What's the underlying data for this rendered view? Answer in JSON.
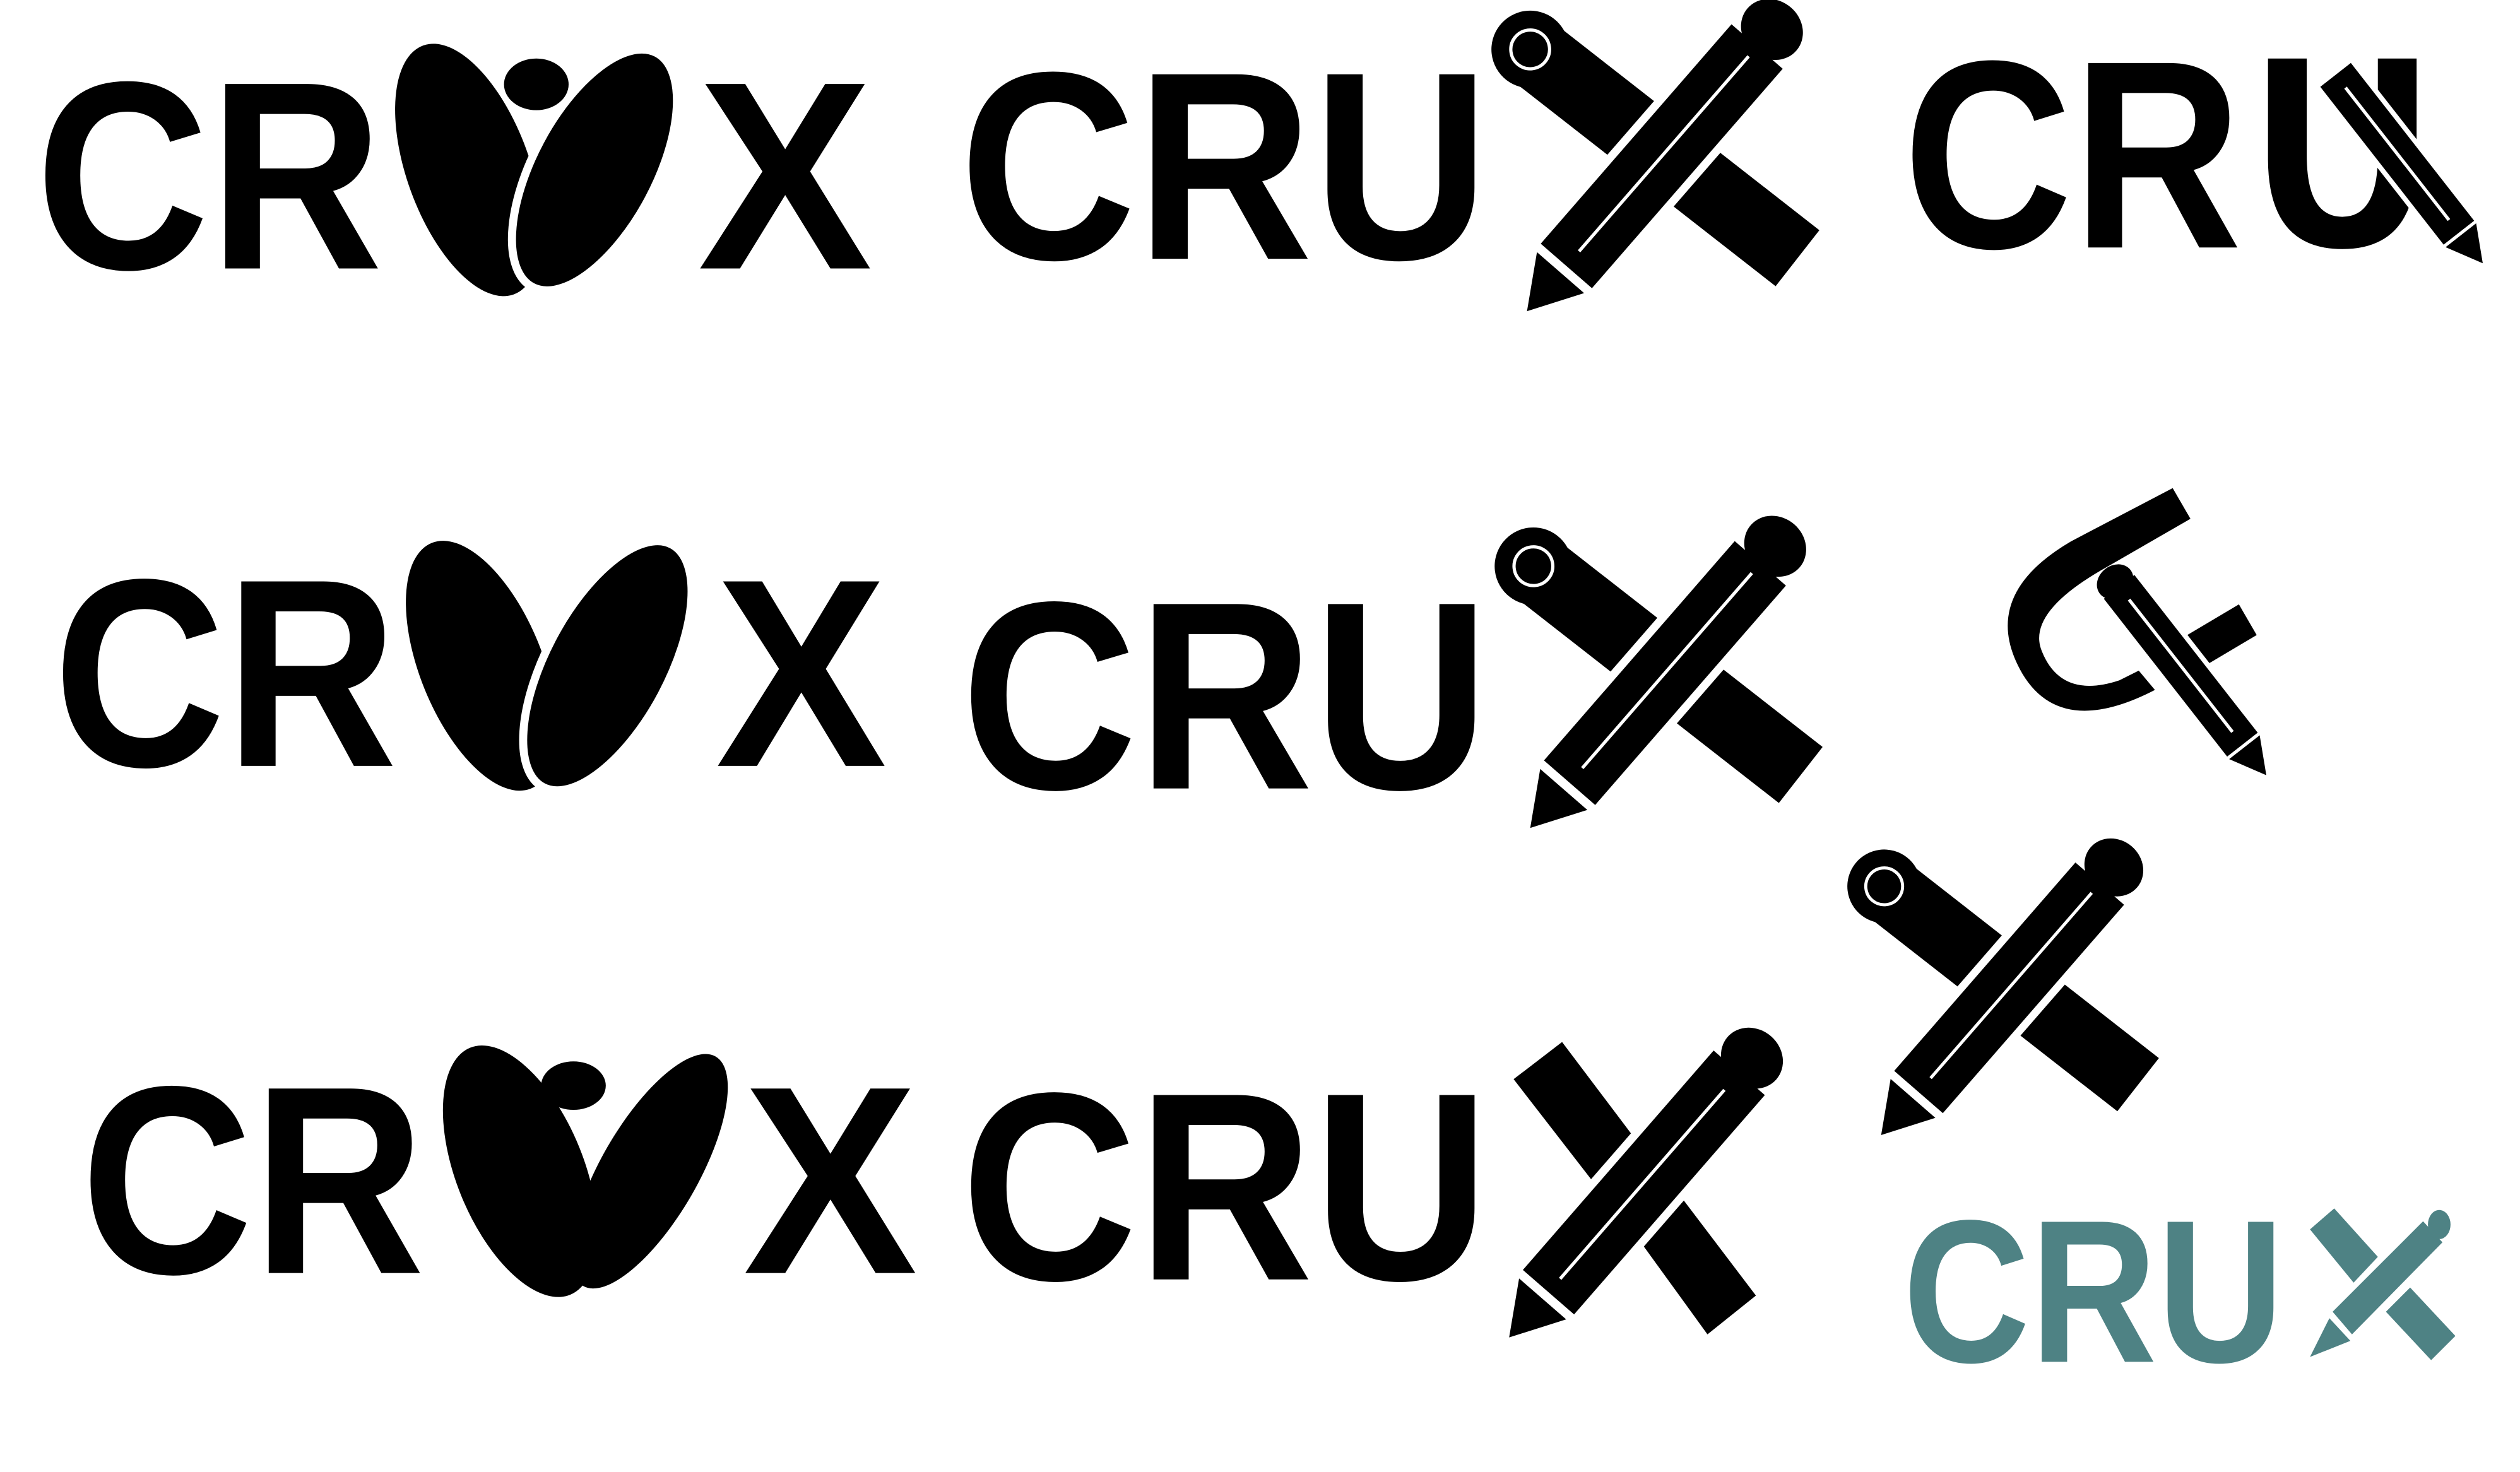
{
  "sheet": {
    "colors": {
      "primary": "#000000",
      "teal": "#4e8284",
      "background": "#ffffff"
    },
    "logos": [
      {
        "variant": "heart-leaves",
        "prefix": "CR",
        "suffix": "X"
      },
      {
        "variant": "pencil-scroll-x",
        "word": "CRU"
      },
      {
        "variant": "pencil-in-u",
        "word": "CR"
      },
      {
        "variant": "leaves-large",
        "prefix": "CR",
        "suffix": "X"
      },
      {
        "variant": "pencil-scroll-x-large",
        "word": "CRU"
      },
      {
        "variant": "g-pencil-mark"
      },
      {
        "variant": "leaves-open",
        "prefix": "CR",
        "suffix": "X"
      },
      {
        "variant": "pencil-bars-x",
        "word": "CRU"
      },
      {
        "variant": "rough-pencil-scroll-x"
      },
      {
        "variant": "teal-wordmark",
        "word": "CRU"
      }
    ]
  }
}
